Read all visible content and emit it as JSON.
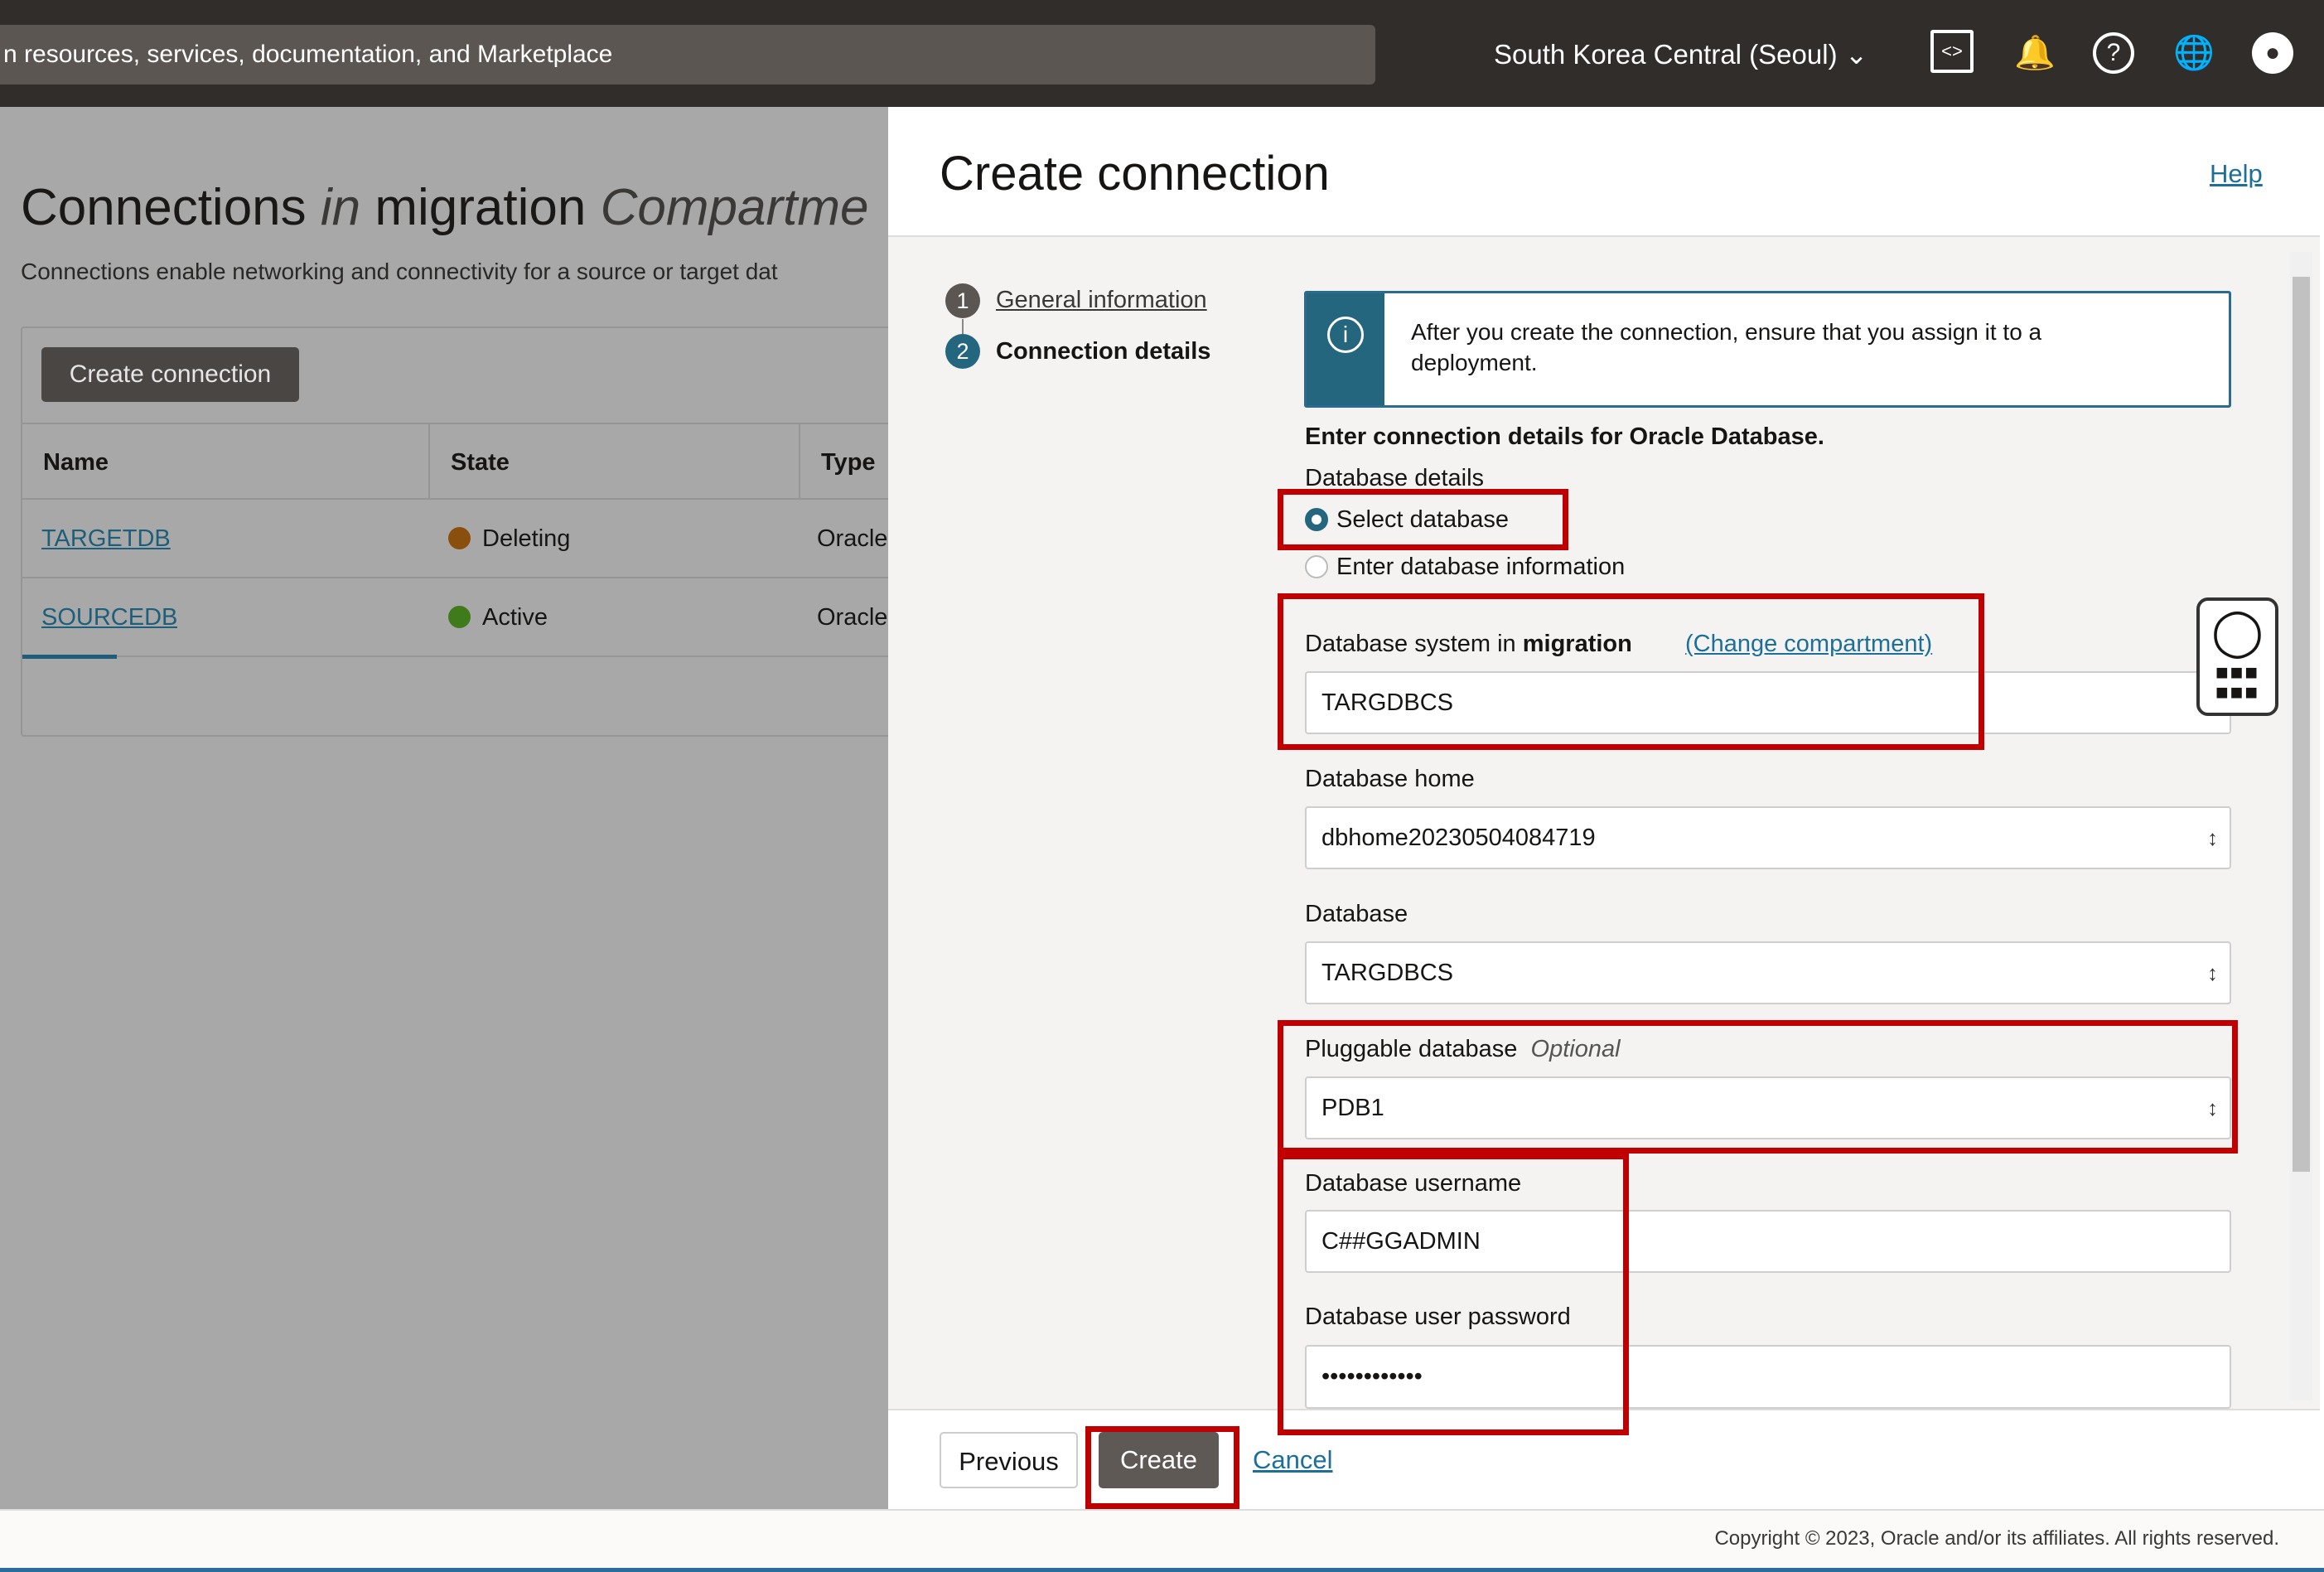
{
  "topbar": {
    "search_placeholder": "n resources, services, documentation, and Marketplace",
    "region": "South Korea Central (Seoul)",
    "icons": [
      "code-editor-icon",
      "bell-icon",
      "help-icon",
      "globe-icon",
      "user-icon"
    ]
  },
  "page": {
    "title_a": "Connections ",
    "title_in": "in",
    "title_b": " migration ",
    "title_c": "Compartme",
    "subtitle": "Connections enable networking and connectivity for a source or target dat",
    "create_button": "Create connection",
    "columns": [
      "Name",
      "State",
      "Type"
    ],
    "rows": [
      {
        "name": "TARGETDB",
        "state": "Deleting",
        "state_color": "#8a4f0c",
        "type": "Oracle"
      },
      {
        "name": "SOURCEDB",
        "state": "Active",
        "state_color": "#3f7b1a",
        "type": "Oracle"
      }
    ]
  },
  "panel": {
    "title": "Create connection",
    "help": "Help",
    "steps": [
      {
        "num": "1",
        "label": "General information"
      },
      {
        "num": "2",
        "label": "Connection details"
      }
    ],
    "info": "After you create the connection, ensure that you assign it to a deployment.",
    "section_heading": "Enter connection details for Oracle Database.",
    "db_details_label": "Database details",
    "radio_select": "Select database",
    "radio_enter": "Enter database information",
    "db_system_label": "Database system in ",
    "db_system_compartment": "migration",
    "change_compartment": "(Change compartment)",
    "db_system_value": "TARGDBCS",
    "db_home_label": "Database home",
    "db_home_value": "dbhome20230504084719",
    "database_label": "Database",
    "database_value": "TARGDBCS",
    "pdb_label": "Pluggable database",
    "pdb_optional": "Optional",
    "pdb_value": "PDB1",
    "username_label": "Database username",
    "username_value": "C##GGADMIN",
    "password_label": "Database user password",
    "password_value": "••••••••••••",
    "previous": "Previous",
    "create": "Create",
    "cancel": "Cancel"
  },
  "footer": {
    "copyright": "Copyright © 2023, Oracle and/or its affiliates. All rights reserved."
  },
  "colors": {
    "accent": "#25667f",
    "annotation": "#c00000",
    "topbar": "#312d2a"
  }
}
